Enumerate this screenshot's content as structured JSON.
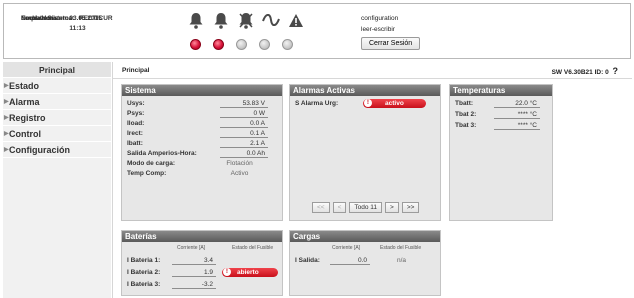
{
  "header": {
    "labels": {
      "system_name": "Nombre Sistema:",
      "location": "Emplazamiento:",
      "datetime": "Fecha/Hora:"
    },
    "values": {
      "system_name": "F.",
      "location": "RECTICUR",
      "datetime": "03.05.2015 11:13"
    },
    "user": {
      "role": "configuration",
      "access": "leer-escribir",
      "logout_label": "Cerrar Sesión"
    },
    "leds": [
      "red",
      "red",
      "grey",
      "grey",
      "grey"
    ]
  },
  "sidebar": {
    "items": [
      {
        "label": "Principal"
      },
      {
        "label": "Estado"
      },
      {
        "label": "Alarma"
      },
      {
        "label": "Registro"
      },
      {
        "label": "Control"
      },
      {
        "label": "Configuración"
      }
    ]
  },
  "main": {
    "breadcrumb": "Principal",
    "version": "SW V6.30B21",
    "id": "ID: 0",
    "help": "?"
  },
  "sistema": {
    "title": "Sistema",
    "rows": [
      {
        "label": "Usys:",
        "value": "53.83 V"
      },
      {
        "label": "Psys:",
        "value": "0 W"
      },
      {
        "label": "Iload:",
        "value": "0.0 A"
      },
      {
        "label": "Irect:",
        "value": "0.1 A"
      },
      {
        "label": "Ibatt:",
        "value": "2.1 A"
      },
      {
        "label": "Salida Amperios-Hora:",
        "value": "0.0 Ah"
      },
      {
        "label": "Modo de carga:",
        "value": "Flotación"
      },
      {
        "label": "Temp Comp:",
        "value": "Activo"
      }
    ]
  },
  "alarmas": {
    "title": "Alarmas Activas",
    "row_label": "S Alarma Urg:",
    "status": "activo",
    "pager": {
      "first": "<<",
      "prev": "<",
      "all": "Todo 11",
      "next": ">",
      "last": ">>"
    }
  },
  "temperaturas": {
    "title": "Temperaturas",
    "rows": [
      {
        "label": "Tbatt:",
        "value": "22.0 °C"
      },
      {
        "label": "Tbat 2:",
        "value": "**** °C"
      },
      {
        "label": "Tbat 3:",
        "value": "**** °C"
      }
    ]
  },
  "baterias": {
    "title": "Baterías",
    "col_current": "Corriente [A]",
    "col_fuse": "Estado del Fusible",
    "rows": [
      {
        "label": "I Bateria 1:",
        "value": "3.4",
        "fuse": ""
      },
      {
        "label": "I Bateria 2:",
        "value": "1.9",
        "fuse": "abierto"
      },
      {
        "label": "I Bateria 3:",
        "value": "-3.2",
        "fuse": ""
      }
    ]
  },
  "cargas": {
    "title": "Cargas",
    "col_current": "Corriente [A]",
    "col_fuse": "Estado del Fusible",
    "row_label": "I Salida:",
    "value": "0.0",
    "fuse": "n/a"
  }
}
